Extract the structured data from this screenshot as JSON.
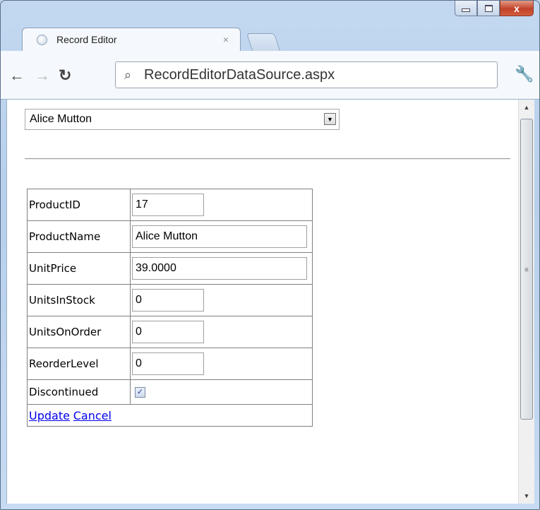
{
  "browser": {
    "tab_title": "Record Editor",
    "tab_close": "×",
    "url": "RecordEditorDataSource.aspx",
    "window_controls": {
      "minimize": "",
      "maximize": "",
      "close": "x"
    }
  },
  "record_select": {
    "selected": "Alice Mutton"
  },
  "fields": [
    {
      "label": "ProductID",
      "value": "17",
      "size": "short"
    },
    {
      "label": "ProductName",
      "value": "Alice Mutton",
      "size": "long"
    },
    {
      "label": "UnitPrice",
      "value": "39.0000",
      "size": "long"
    },
    {
      "label": "UnitsInStock",
      "value": "0",
      "size": "short"
    },
    {
      "label": "UnitsOnOrder",
      "value": "0",
      "size": "short"
    },
    {
      "label": "ReorderLevel",
      "value": "0",
      "size": "short"
    }
  ],
  "discontinued": {
    "label": "Discontinued",
    "checked": true
  },
  "actions": {
    "update": "Update",
    "cancel": "Cancel"
  },
  "icons": {
    "back": "back-arrow-icon",
    "forward": "forward-arrow-icon",
    "reload": "reload-icon",
    "search": "search-icon",
    "wrench": "wrench-icon",
    "globe": "globe-icon"
  }
}
